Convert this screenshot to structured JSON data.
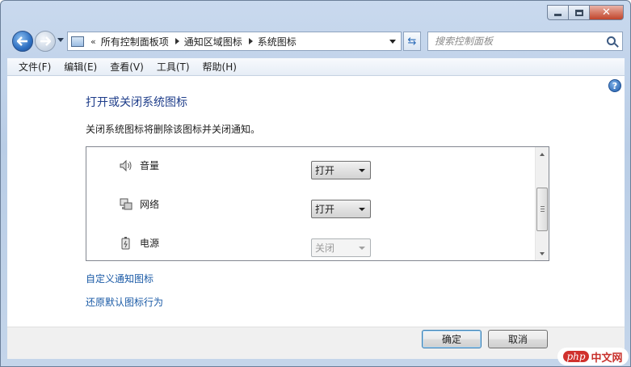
{
  "address": {
    "overflow": "«",
    "crumbs": [
      "所有控制面板项",
      "通知区域图标",
      "系统图标"
    ]
  },
  "search": {
    "placeholder": "搜索控制面板"
  },
  "menu": [
    "文件(F)",
    "编辑(E)",
    "查看(V)",
    "工具(T)",
    "帮助(H)"
  ],
  "help": {
    "symbol": "?"
  },
  "page": {
    "title": "打开或关闭系统图标",
    "description": "关闭系统图标将删除该图标并关闭通知。"
  },
  "icons": [
    {
      "icon": "volume-icon",
      "label": "音量",
      "value": "打开",
      "enabled": true
    },
    {
      "icon": "network-icon",
      "label": "网络",
      "value": "打开",
      "enabled": true
    },
    {
      "icon": "power-icon",
      "label": "电源",
      "value": "关闭",
      "enabled": false
    }
  ],
  "links": {
    "customize": "自定义通知图标",
    "restore": "还原默认图标行为"
  },
  "buttons": {
    "ok": "确定",
    "cancel": "取消"
  },
  "watermark": {
    "php": "php",
    "cn": "中文网"
  },
  "colors": {
    "link": "#1a5aa6",
    "title": "#1e3d8a",
    "frame": "#b9cde6"
  }
}
